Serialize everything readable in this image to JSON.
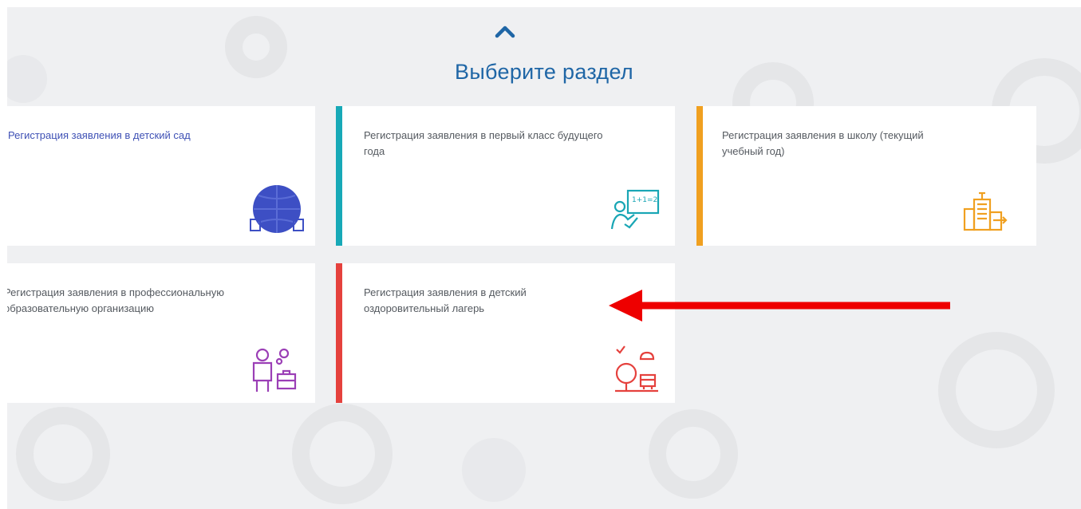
{
  "header": {
    "collapse_icon": "chevron-up-icon",
    "title": "Выберите раздел"
  },
  "cards": [
    {
      "label": "Регистрация заявления в детский сад",
      "accent": null,
      "icon": "globe-icon",
      "icon_color": "#3d4fc4",
      "label_color": "#3f51b5"
    },
    {
      "label": "Регистрация заявления в первый класс будущего года",
      "accent": "#17a9b7",
      "icon": "teacher-board-icon",
      "icon_color": "#19a6b5"
    },
    {
      "label": "Регистрация заявления в школу (текущий учебный год)",
      "accent": "#f0a020",
      "icon": "school-building-icon",
      "icon_color": "#f0a020"
    },
    {
      "label": "Регистрация заявления в профессиональную образовательную организацию",
      "accent": null,
      "icon": "worker-briefcase-icon",
      "icon_color": "#9b3fb6"
    },
    {
      "label": "Регистрация заявления в детский оздоровительный лагерь",
      "accent": "#e5413d",
      "icon": "camp-tree-icon",
      "icon_color": "#e5413d"
    }
  ],
  "annotation": {
    "arrow_color": "#ee0000",
    "arrow_icon": "left-arrow-icon"
  }
}
